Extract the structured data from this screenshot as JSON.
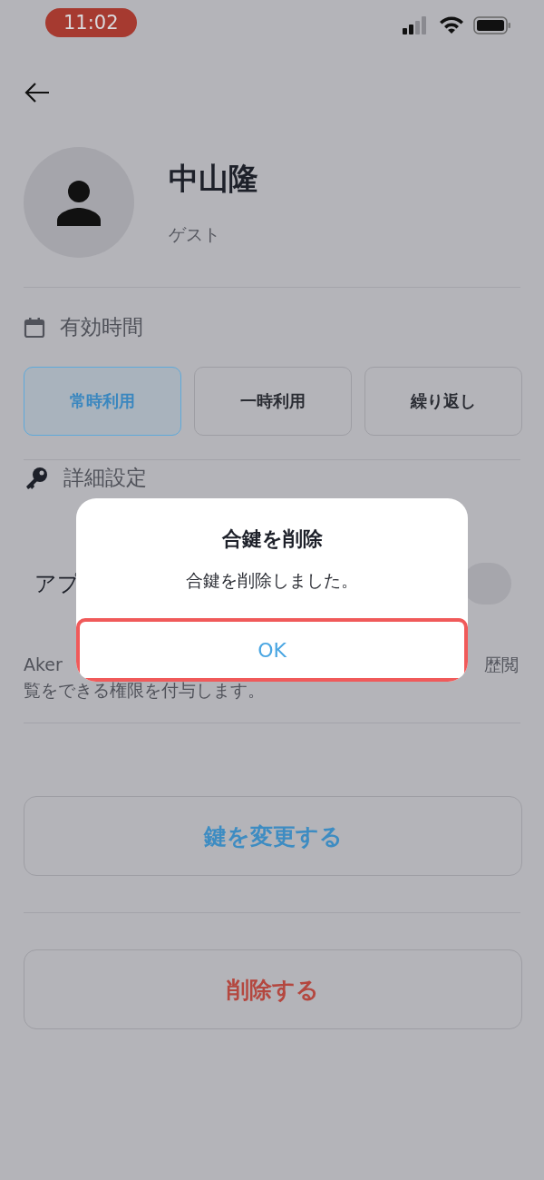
{
  "status_bar": {
    "time": "11:02"
  },
  "profile": {
    "name": "中山隆",
    "role": "ゲスト"
  },
  "validity": {
    "heading": "有効時間",
    "options": [
      {
        "label": "常時利用",
        "selected": true
      },
      {
        "label": "一時利用",
        "selected": false
      },
      {
        "label": "繰り返し",
        "selected": false
      }
    ]
  },
  "advanced": {
    "heading": "詳細設定",
    "toggle_label": "アプ",
    "toggle": {
      "on": false
    },
    "description": [
      "Aker",
      "歴閲",
      "覧をできる権限を付与します。"
    ]
  },
  "actions": [
    {
      "label": "鍵を変更する",
      "kind": "primary"
    },
    {
      "label": "削除する",
      "kind": "danger"
    }
  ],
  "dialog": {
    "title": "合鍵を削除",
    "message": "合鍵を削除しました。",
    "button": "OK",
    "highlighted": true
  }
}
